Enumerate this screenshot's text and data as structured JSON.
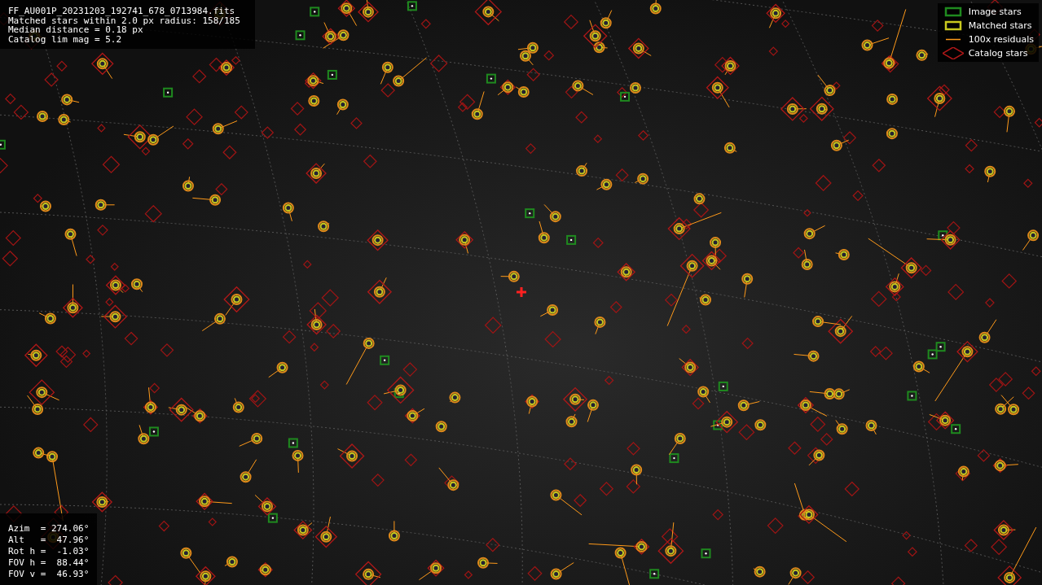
{
  "info": {
    "lines": [
      "FF_AU001P_20231203_192741_678_0713984.fits",
      "Matched stars within 2.0 px radius: 158/185",
      "Median distance = 0.18 px",
      "Catalog lim mag = 5.2"
    ]
  },
  "legend": {
    "items": [
      {
        "kind": "image",
        "label": "Image stars",
        "color": "#1f8a1f"
      },
      {
        "kind": "matched",
        "label": "Matched stars",
        "color": "#c8c81e"
      },
      {
        "kind": "residual",
        "label": "100x residuals",
        "color": "#ff9a1a"
      },
      {
        "kind": "catalog",
        "label": "Catalog stars",
        "color": "#b01818"
      }
    ]
  },
  "pointing": {
    "lines": [
      "Azim  = 274.06°",
      "Alt   =  47.96°",
      "Rot h =  -1.03°",
      "FOV h =  88.44°",
      "FOV v =  46.93°"
    ]
  }
}
